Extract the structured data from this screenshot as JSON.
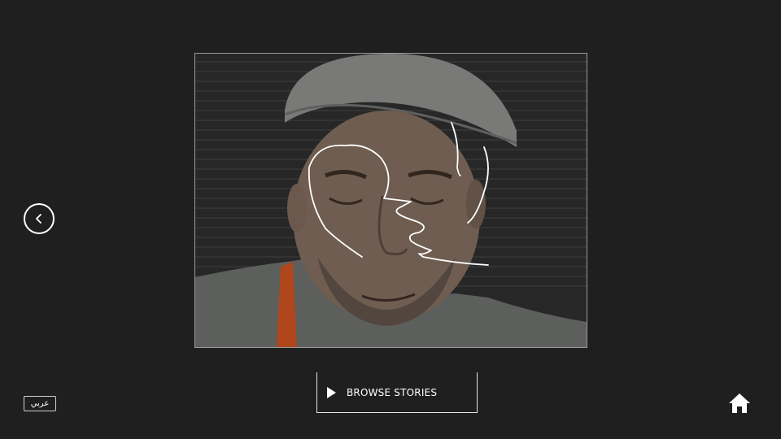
{
  "photo": {
    "subject": "selfie-with-drawn-face-outline",
    "overlay_stroke_color": "#ffffff"
  },
  "navigation": {
    "back_icon": "chevron-left-icon",
    "home_icon": "home-icon"
  },
  "browse": {
    "label": "BROWSE STORIES",
    "icon": "play-icon"
  },
  "language": {
    "label": "عربي"
  },
  "colors": {
    "background": "#1f1f1f",
    "foreground": "#ffffff",
    "accent_shirt": "#c9501f"
  }
}
